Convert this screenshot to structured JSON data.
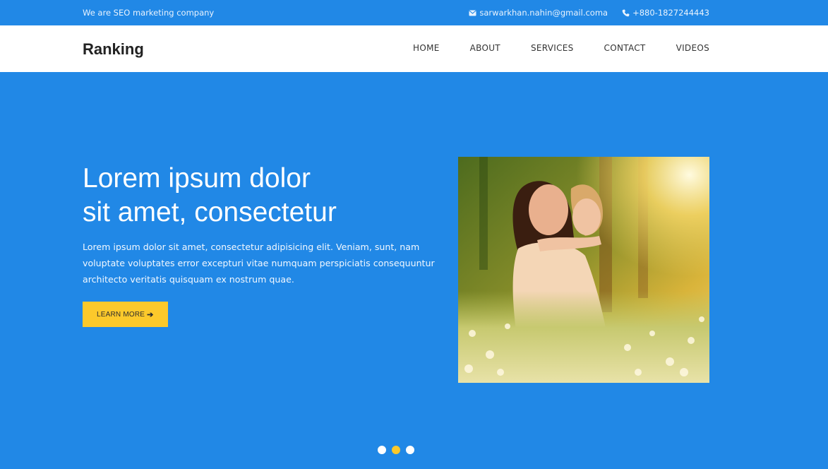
{
  "topbar": {
    "tagline": "We are SEO marketing company",
    "email": "sarwarkhan.nahin@gmail.coma",
    "email_icon": "envelope-icon",
    "phone": "+880-1827244443",
    "phone_icon": "phone-icon"
  },
  "navbar": {
    "brand": "Ranking",
    "menu": [
      "HOME",
      "ABOUT",
      "SERVICES",
      "CONTACT",
      "VIDEOS"
    ]
  },
  "hero": {
    "title_line1": "Lorem ipsum dolor",
    "title_line2": "sit amet, consectetur",
    "description": "Lorem ipsum dolor sit amet, consectetur adipisicing elit. Veniam, sunt, nam voluptate voluptates error excepturi vitae numquam perspiciatis consequuntur architecto veritatis quisquam ex nostrum quae.",
    "button_label": "LEARN MORE",
    "button_icon": "arrow-right-icon",
    "image": "mother-and-daughter-in-meadow-photo"
  },
  "slider": {
    "slide_count": 3,
    "active_slide": 2
  },
  "colors": {
    "primary_blue": "#2188e6",
    "accent_yellow": "#fcc92b",
    "white": "#ffffff",
    "brand_text": "#222222"
  }
}
